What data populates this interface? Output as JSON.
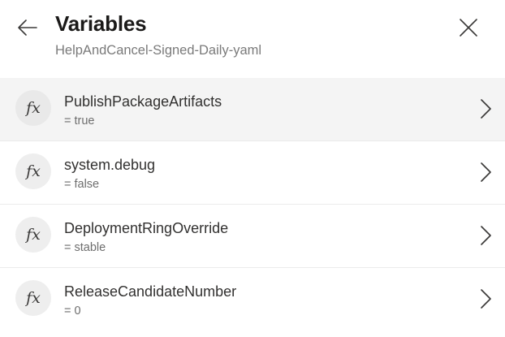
{
  "header": {
    "title": "Variables",
    "subtitle": "HelpAndCancel-Signed-Daily-yaml",
    "back_icon": "arrow-left-icon",
    "close_icon": "close-icon"
  },
  "variables": [
    {
      "icon_text": "fx",
      "name": "PublishPackageArtifacts",
      "value": "= true",
      "selected": true
    },
    {
      "icon_text": "fx",
      "name": "system.debug",
      "value": "= false",
      "selected": false
    },
    {
      "icon_text": "fx",
      "name": "DeploymentRingOverride",
      "value": "= stable",
      "selected": false
    },
    {
      "icon_text": "fx",
      "name": "ReleaseCandidateNumber",
      "value": "= 0",
      "selected": false
    }
  ],
  "colors": {
    "selected_row_bg": "#f4f4f4",
    "icon_circle_bg": "#eeeeee",
    "title": "#1b1a19",
    "secondary_text": "#7a7a7a"
  }
}
